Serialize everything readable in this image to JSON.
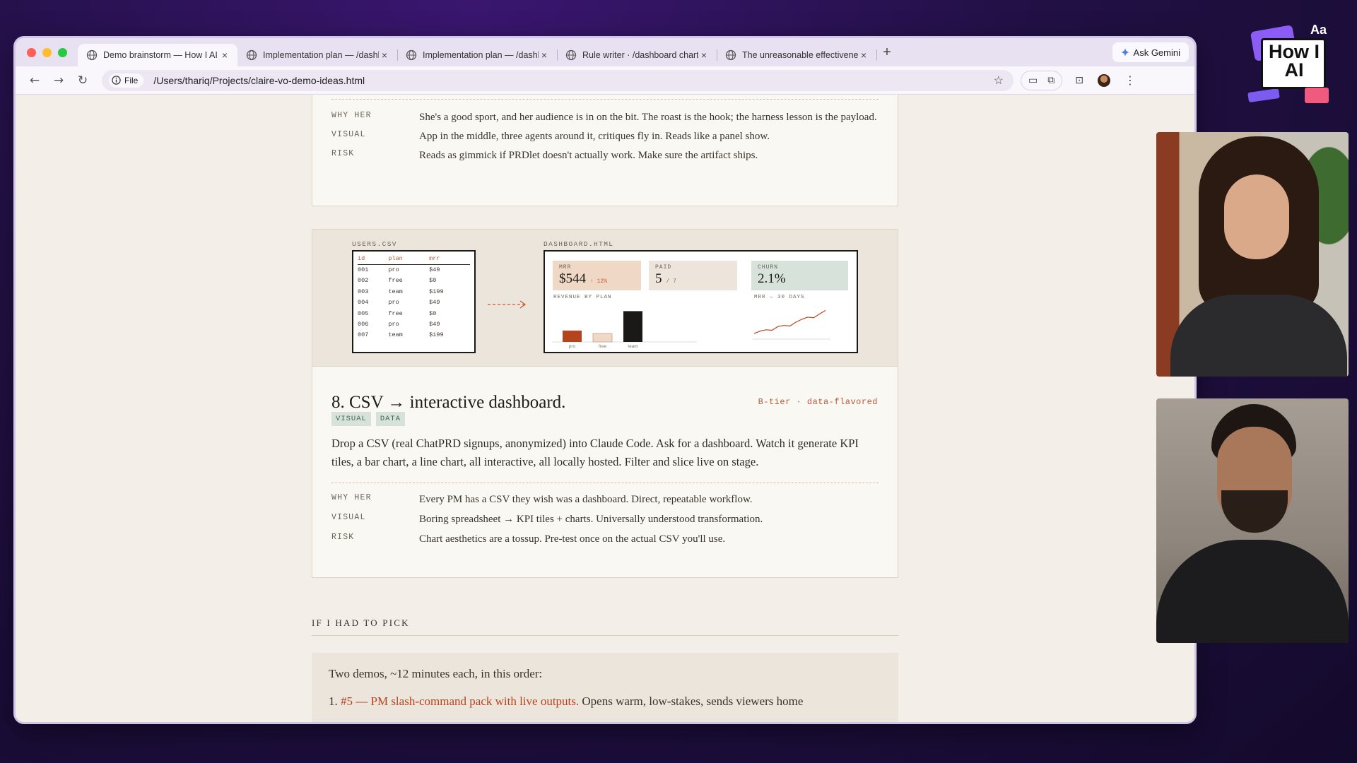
{
  "browser": {
    "tabs": [
      {
        "title": "Demo brainstorm — How I AI"
      },
      {
        "title": "Implementation plan — /dashb"
      },
      {
        "title": "Implementation plan — /dashb"
      },
      {
        "title": "Rule writer · /dashboard chart"
      },
      {
        "title": "The unreasonable effectiveness"
      }
    ],
    "new_tab": "+",
    "gemini_label": "Ask Gemini",
    "close_glyph": "×",
    "address_chip": "File",
    "url": "/Users/thariq/Projects/claire-vo-demo-ideas.html"
  },
  "prev_card": {
    "rows": [
      {
        "label": "WHY HER",
        "value": "She's a good sport, and her audience is in on the bit. The roast is the hook; the harness lesson is the payload."
      },
      {
        "label": "VISUAL",
        "value": "App in the middle, three agents around it, critiques fly in. Reads like a panel show."
      },
      {
        "label": "RISK",
        "value": "Reads as gimmick if PRDlet doesn't actually work. Make sure the artifact ships."
      }
    ]
  },
  "card8": {
    "preview": {
      "csv_caption": "USERS.CSV",
      "csv_headers": [
        "id",
        "plan",
        "mrr"
      ],
      "csv_rows": [
        [
          "001",
          "pro",
          "$49"
        ],
        [
          "002",
          "free",
          "$0"
        ],
        [
          "003",
          "team",
          "$199"
        ],
        [
          "004",
          "pro",
          "$49"
        ],
        [
          "005",
          "free",
          "$0"
        ],
        [
          "006",
          "pro",
          "$49"
        ],
        [
          "007",
          "team",
          "$199"
        ]
      ],
      "dash_caption": "DASHBOARD.HTML",
      "kpis": [
        {
          "label": "MRR",
          "value": "$544",
          "sub": "↑ 12%",
          "color": "#f0d8c6"
        },
        {
          "label": "PAID",
          "value": "5",
          "sub": "/ 7",
          "color": "#ede4dc"
        },
        {
          "label": "CHURN",
          "value": "2.1%",
          "sub": "",
          "color": "#d6e2da"
        }
      ],
      "bar_caption": "REVENUE BY PLAN",
      "line_caption": "MRR — 30 DAYS"
    },
    "title": "8. CSV → interactive dashboard.",
    "tier": "B-tier · data-flavored",
    "tags": [
      "VISUAL",
      "DATA"
    ],
    "description": "Drop a CSV (real ChatPRD signups, anonymized) into Claude Code. Ask for a dashboard. Watch it generate KPI tiles, a bar chart, a line chart, all interactive, all locally hosted. Filter and slice live on stage.",
    "rows": [
      {
        "label": "WHY HER",
        "value": "Every PM has a CSV they wish was a dashboard. Direct, repeatable workflow."
      },
      {
        "label": "VISUAL",
        "value": "Boring spreadsheet → KPI tiles + charts. Universally understood transformation."
      },
      {
        "label": "RISK",
        "value": "Chart aesthetics are a tossup. Pre-test once on the actual CSV you'll use."
      }
    ]
  },
  "chart_data": [
    {
      "type": "bar",
      "title": "REVENUE BY PLAN",
      "categories": [
        "pro",
        "free",
        "team"
      ],
      "values": [
        147,
        0,
        398
      ],
      "colors": [
        "#b5441e",
        "#f0d8c6",
        "#1b1917"
      ]
    },
    {
      "type": "line",
      "title": "MRR — 30 DAYS",
      "values": [
        0.05,
        0.14,
        0.19,
        0.17,
        0.31,
        0.35,
        0.33,
        0.47,
        0.58,
        0.66,
        0.64,
        0.78,
        0.91
      ],
      "color": "#b5441e"
    }
  ],
  "pick": {
    "heading": "IF I HAD TO PICK",
    "intro": "Two demos, ~12 minutes each, in this order:",
    "item1_num": "1.",
    "item1_link": "#5 — PM slash-command pack with live outputs.",
    "item1_text": " Opens warm, low-stakes, sends viewers home"
  },
  "overlay": {
    "logo_text": "How I AI",
    "logo_aa": "Aa"
  },
  "colors": {
    "accent": "#b5441e",
    "page_bg": "#f3efe8",
    "card_bg": "#faf8f3",
    "tag_bg": "#d6e2da"
  }
}
